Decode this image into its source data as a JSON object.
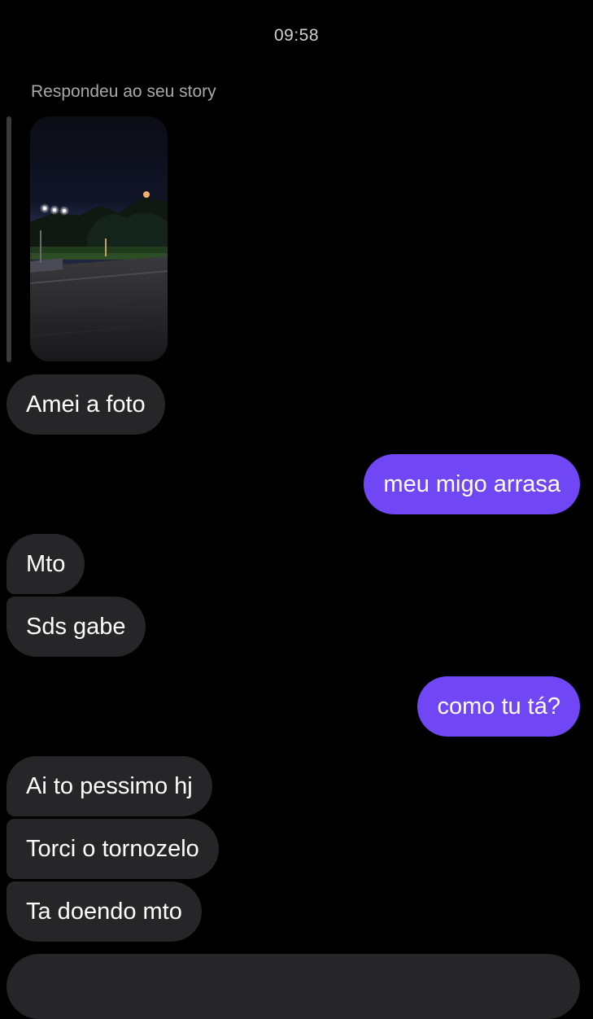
{
  "header": {
    "timestamp": "09:58"
  },
  "story_reply": {
    "caption": "Respondeu ao seu story"
  },
  "messages": [
    {
      "direction": "in",
      "text": "Amei a foto"
    },
    {
      "direction": "out",
      "text": "meu migo arrasa"
    },
    {
      "direction": "in",
      "text": "Mto"
    },
    {
      "direction": "in",
      "text": "Sds gabe"
    },
    {
      "direction": "out",
      "text": "como tu tá?"
    },
    {
      "direction": "in",
      "text": "Ai to pessimo hj"
    },
    {
      "direction": "in",
      "text": "Torci o tornozelo"
    },
    {
      "direction": "in",
      "text": "Ta doendo mto"
    }
  ],
  "colors": {
    "background": "#000000",
    "incoming_bubble": "#262628",
    "outgoing_bubble": "#7147f5",
    "caption_text": "#a8a8a8"
  }
}
